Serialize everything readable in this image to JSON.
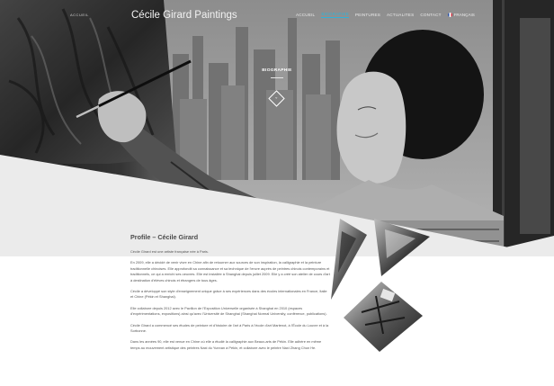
{
  "nav": {
    "small_logo": "ACCUEIL",
    "logo": "Cécile Girard Paintings",
    "items": [
      {
        "label": "ACCUEIL",
        "active": false
      },
      {
        "label": "BIOGRAPHIE",
        "active": true
      },
      {
        "label": "PEINTURES",
        "active": false
      },
      {
        "label": "ACTUALITES",
        "active": false
      },
      {
        "label": "CONTACT",
        "active": false
      }
    ],
    "language": "FRANÇAIS"
  },
  "hero": {
    "section_label": "BIOGRAPHIE",
    "scroll_icon": "chevron-down-icon"
  },
  "content": {
    "title": "Profile – Cécile Girard",
    "paragraphs": [
      "Cécile Girard est une artiste française née à Paris.",
      "En 2009, elle a décidé de venir vivre en Chine afin de retourner aux sources de son inspiration, la calligraphie et la peinture traditionnelle chinoises. Elle approfondit sa connaissance et sa technique de l'encre auprès de peintres chinois contemporains et traditionnels, ce qui a enrichi ses oeuvres. Elle est installée à Shanghai depuis juillet 2009. Elle y a créé son atelier de cours d'art à destination d'élèves chinois et étrangers de tous âges.",
      "Cécile a développé son style d'enseignement unique grâce à ses expériences dans des écoles internationales en France, Italie et Chine (Pékin et Shanghai).",
      "Elle collabore depuis 2012 avec le Pavillon de l'Exposition Universelle organisée à Shanghai en 2010 (espaces d'expérimentations, expositions) ainsi qu'avec l'Université de Shanghai (Shanghai Normal University, conférence, publications).",
      "Cécile Girard a commencé ses études de peinture et d'histoire de l'art à Paris à l'école d'art Martenot, à l'École du Louvre et à la Sorbonne.",
      "Dans les années 90, elle est venue en Chine où elle a étudié la calligraphie aux Beaux-arts de Pékin. Elle adhère en même temps au mouvement artistique des peintres Naxi du Yunnan à Pékin, et collabore avec le peintre Naxi Zhang Chun He."
    ]
  },
  "colors": {
    "accent": "#2fb3d9",
    "background": "#ffffff",
    "text": "#555555"
  }
}
